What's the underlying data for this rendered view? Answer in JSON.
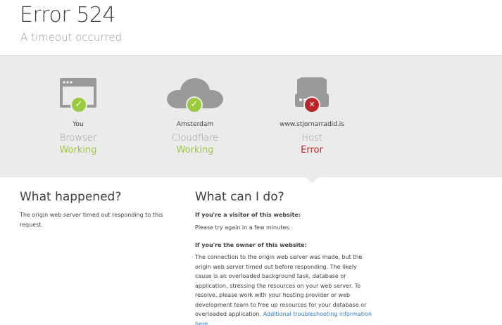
{
  "header": {
    "title": "Error 524",
    "subtitle": "A timeout occurred"
  },
  "status": [
    {
      "location": "You",
      "name": "Browser",
      "state": "Working",
      "icon": "browser-icon",
      "badge": "check-icon"
    },
    {
      "location": "Amsterdam",
      "name": "Cloudflare",
      "state": "Working",
      "icon": "cloud-icon",
      "badge": "check-icon"
    },
    {
      "location": "www.stjornarradid.is",
      "name": "Host",
      "state": "Error",
      "icon": "server-icon",
      "badge": "x-icon"
    }
  ],
  "info": {
    "what_happened_title": "What happened?",
    "what_happened_text": "The origin web server timed out responding to this request.",
    "what_can_title": "What can I do?",
    "visitor_heading": "If you're a visitor of this website:",
    "visitor_text": "Please try again in a few minutes.",
    "owner_heading": "If you're the owner of this website:",
    "owner_text": "The connection to the origin web server was made, but the origin web server timed out before responding. The likely cause is an overloaded background task, database or application, stressing the resources on your web server. To resolve, please work with your hosting provider or web development team to free up resources for your database or overloaded application.",
    "owner_link": "Additional troubleshooting information here",
    "owner_link_suffix": "."
  },
  "colors": {
    "working": "#9bca3e",
    "error": "#bd2426",
    "band": "#ebebeb",
    "icon_gray": "#999999",
    "link": "#2f7bbf"
  }
}
